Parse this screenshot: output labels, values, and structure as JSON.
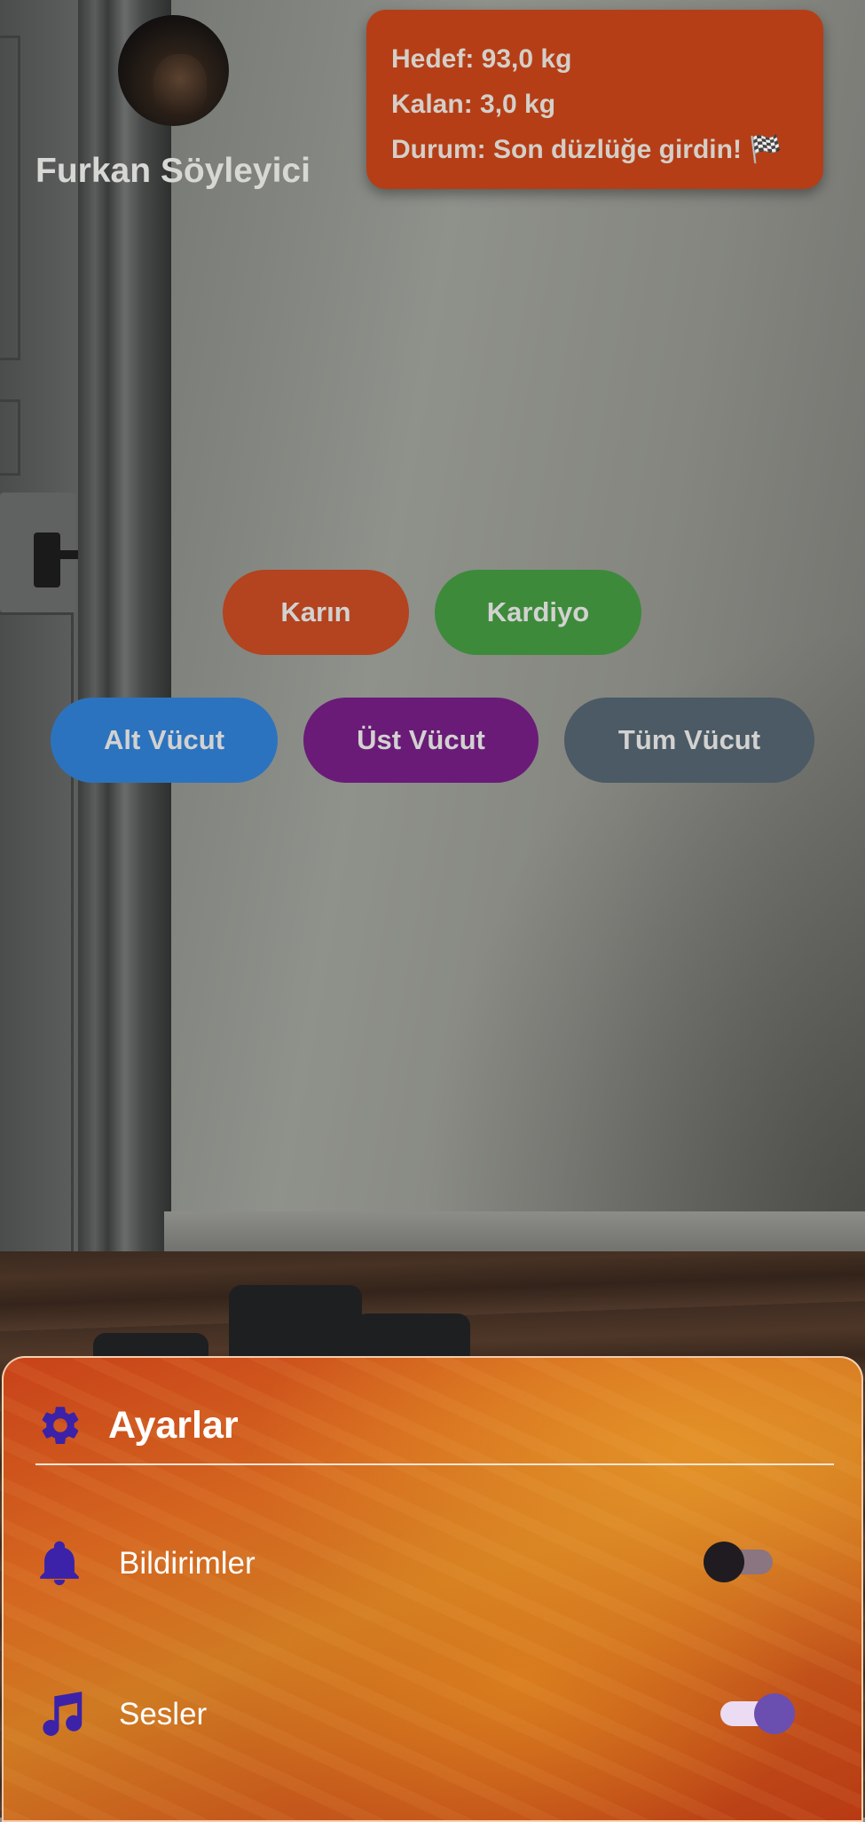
{
  "profile": {
    "name": "Furkan Söyleyici"
  },
  "goal": {
    "target": "Hedef: 93,0 kg",
    "remaining": "Kalan: 3,0 kg",
    "status": "Durum: Son düzlüğe girdin! 🏁"
  },
  "categories": [
    {
      "label": "Karın",
      "color": "#b4431f"
    },
    {
      "label": "Kardiyo",
      "color": "#3d8a3b"
    },
    {
      "label": "Alt Vücut",
      "color": "#2c73bf"
    },
    {
      "label": "Üst Vücut",
      "color": "#6a1b78"
    },
    {
      "label": "Tüm Vücut",
      "color": "#4b5a64"
    }
  ],
  "settings": {
    "title": "Ayarlar",
    "title_icon": "gear-icon",
    "items": [
      {
        "label": "Bildirimler",
        "icon": "bell-icon",
        "enabled": false
      },
      {
        "label": "Sesler",
        "icon": "music-note-icon",
        "enabled": true
      }
    ]
  },
  "colors": {
    "goal_card": "#b53e16",
    "icon_purple": "#3b22a8",
    "toggle_on": "#6b4fb0"
  }
}
